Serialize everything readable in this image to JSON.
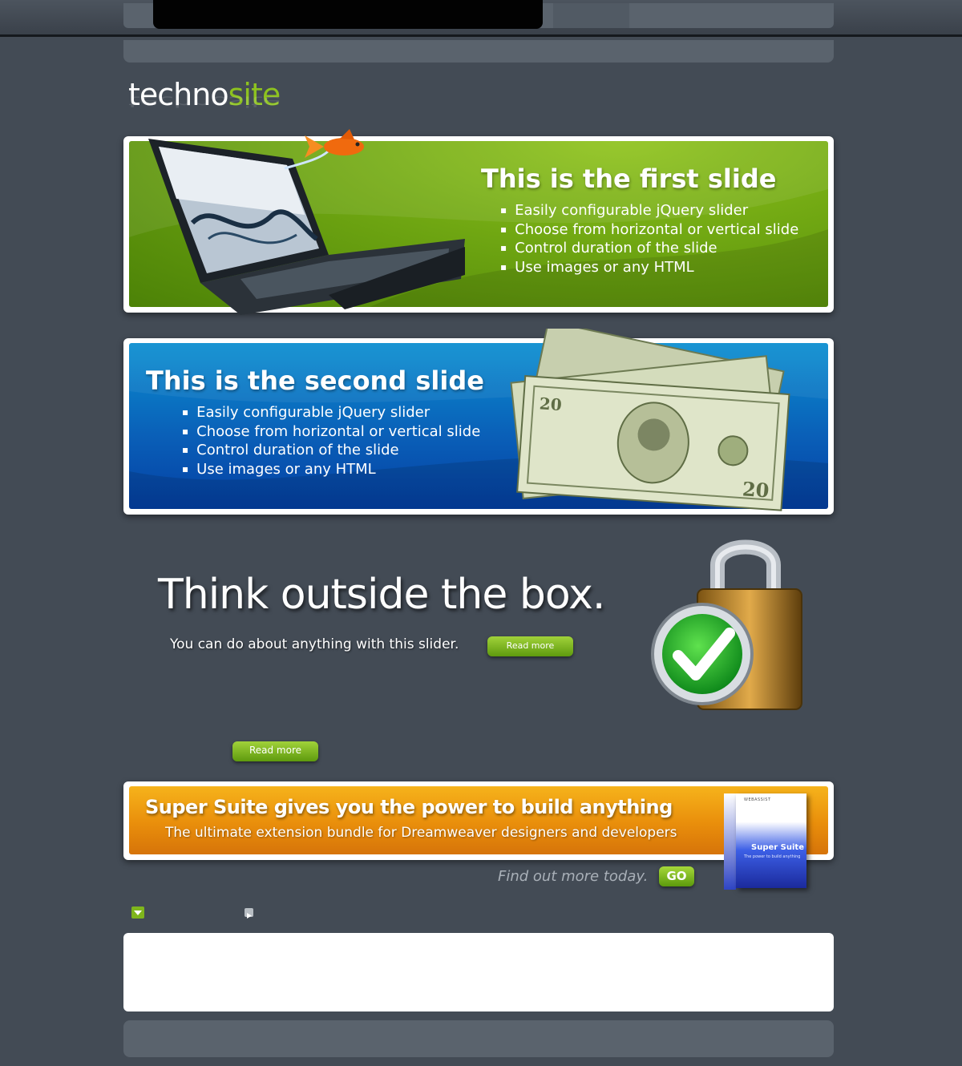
{
  "logo": {
    "part1": "techno",
    "part2": "site"
  },
  "slides": [
    {
      "title": "This is the first slide",
      "bullets": [
        "Easily configurable jQuery slider",
        "Choose from horizontal or vertical slide",
        "Control duration of the slide",
        "Use images or any HTML"
      ]
    },
    {
      "title": "This is the second slide",
      "bullets": [
        "Easily configurable jQuery slider",
        "Choose from horizontal or vertical slide",
        "Control duration of the slide",
        "Use images or any HTML"
      ]
    }
  ],
  "think": {
    "headline": "Think outside the box.",
    "subtext": "You can do about anything with this slider.",
    "read_more": "Read more"
  },
  "read_more_standalone": "Read more",
  "banner": {
    "headline": "Super Suite gives you the power to build anything",
    "subline": "The ultimate extension bundle for Dreamweaver designers and developers",
    "box_title": "Super Suite",
    "box_tagline": "The power to build anything",
    "box_brand": "WEBASSIST",
    "find_more": "Find out more today.",
    "go_label": "GO"
  },
  "colors": {
    "page_bg": "#434b55",
    "accent_green": "#8dc21f",
    "slide1_green": "#6fa612",
    "slide2_blue": "#0a60b8",
    "banner_orange": "#e98e0b"
  },
  "icons": [
    "laptop-icon",
    "goldfish-icon",
    "money-icon",
    "padlock-icon",
    "checkmark-icon",
    "software-box-icon",
    "chevron-down-icon",
    "play-icon"
  ]
}
